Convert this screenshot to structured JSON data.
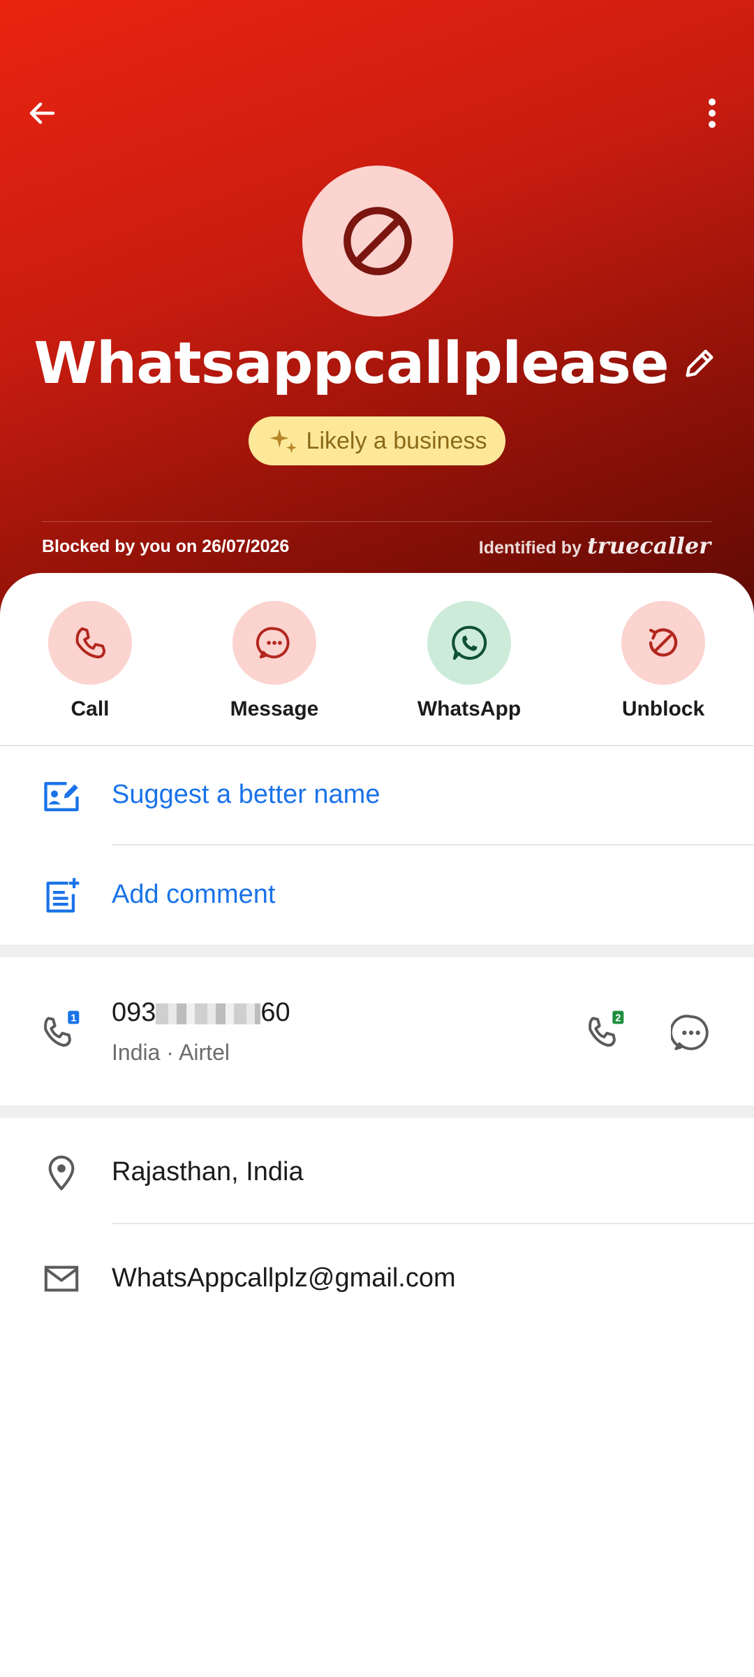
{
  "header": {
    "contact_name": "Whatsappcallplease",
    "badge_label": "Likely a business",
    "blocked_text": "Blocked by you on 26/07/2026",
    "identified_prefix": "Identified by",
    "brand": "truecaller"
  },
  "actions": [
    {
      "label": "Call",
      "icon": "phone-icon"
    },
    {
      "label": "Message",
      "icon": "message-icon"
    },
    {
      "label": "WhatsApp",
      "icon": "whatsapp-icon"
    },
    {
      "label": "Unblock",
      "icon": "unblock-icon"
    }
  ],
  "options": {
    "suggest_name": "Suggest a better name",
    "add_comment": "Add comment"
  },
  "phone": {
    "number_prefix": "093",
    "number_suffix": "60",
    "details": "India · Airtel",
    "sim1_badge": "1",
    "sim2_badge": "2"
  },
  "location": "Rajasthan, India",
  "email": "WhatsAppcallplz@gmail.com",
  "colors": {
    "header_red": "#d01f10",
    "link_blue": "#1a73e8",
    "action_pink": "#fbd3cf",
    "action_green": "#cdebd9",
    "badge_yellow": "#fde89a"
  }
}
